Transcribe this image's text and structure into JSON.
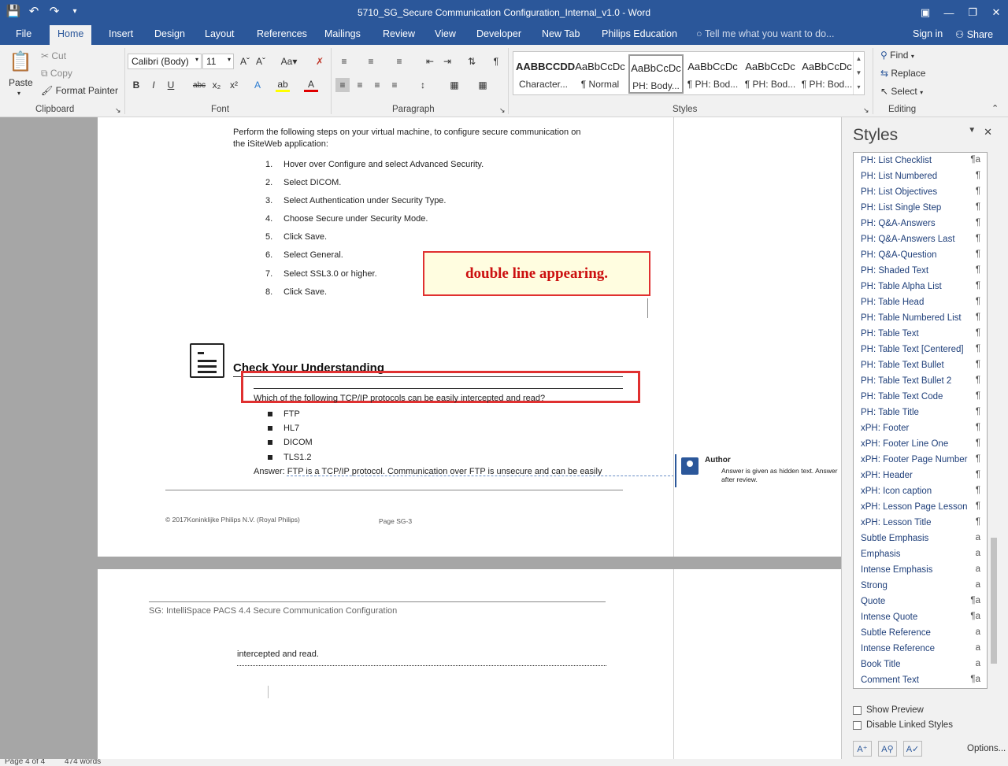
{
  "window": {
    "title": "5710_SG_Secure Communication Configuration_Internal_v1.0 - Word"
  },
  "tabs": [
    "File",
    "Home",
    "Insert",
    "Design",
    "Layout",
    "References",
    "Mailings",
    "Review",
    "View",
    "Developer",
    "New Tab",
    "Philips Education"
  ],
  "tell_me": "Tell me what you want to do...",
  "sign_in": "Sign in",
  "share": "Share",
  "ribbon": {
    "clipboard": {
      "paste": "Paste",
      "cut": "Cut",
      "copy": "Copy",
      "format_painter": "Format Painter",
      "label": "Clipboard"
    },
    "font": {
      "name": "Calibri (Body)",
      "size": "11",
      "label": "Font"
    },
    "paragraph": {
      "label": "Paragraph"
    },
    "styles": {
      "label": "Styles",
      "tiles": [
        {
          "preview": "AABBCCDD",
          "name": "Character..."
        },
        {
          "preview": "AaBbCcDc",
          "name": "¶ Normal"
        },
        {
          "preview": "AaBbCcDc",
          "name": "PH: Body..."
        },
        {
          "preview": "AaBbCcDc",
          "name": "¶ PH: Bod..."
        },
        {
          "preview": "AaBbCcDc",
          "name": "¶ PH: Bod..."
        },
        {
          "preview": "AaBbCcDc",
          "name": "¶ PH: Bod..."
        }
      ]
    },
    "editing": {
      "find": "Find",
      "replace": "Replace",
      "select": "Select",
      "label": "Editing"
    }
  },
  "document": {
    "intro_line1": "Perform the following steps on your virtual machine, to configure secure communication on",
    "intro_line2": "the iSiteWeb application:",
    "steps": [
      {
        "num": "1.",
        "text": "Hover over Configure and select Advanced Security."
      },
      {
        "num": "2.",
        "text": "Select DICOM."
      },
      {
        "num": "3.",
        "text": "Select Authentication under Security Type."
      },
      {
        "num": "4.",
        "text": "Choose Secure under Security Mode."
      },
      {
        "num": "5.",
        "text": "Click Save."
      },
      {
        "num": "6.",
        "text": "Select General."
      },
      {
        "num": "7.",
        "text": "Select SSL3.0 or higher."
      },
      {
        "num": "8.",
        "text": "Click Save."
      }
    ],
    "callout": "double line appearing.",
    "heading": "Check Your Understanding",
    "question": "Which of the following TCP/IP protocols can be easily intercepted and read?",
    "options": [
      "FTP",
      "HL7",
      "DICOM",
      "TLS1.2"
    ],
    "answer": "Answer: FTP is a TCP/IP protocol. Communication over FTP is unsecure and can be easily",
    "footer_copyright": "© 2017Koninklijke Philips N.V. (Royal Philips)",
    "footer_page": "Page SG-3",
    "comment_author": "Author",
    "comment_line1": "Answer is given as hidden text. Answer",
    "comment_line2": "after review.",
    "page2_header": "SG: IntelliSpace PACS 4.4 Secure Communication Configuration",
    "page2_text": "intercepted and read."
  },
  "styles_pane": {
    "title": "Styles",
    "items": [
      {
        "name": "PH: List Checklist",
        "mark": "¶a"
      },
      {
        "name": "PH: List Numbered",
        "mark": "¶"
      },
      {
        "name": "PH: List Objectives",
        "mark": "¶"
      },
      {
        "name": "PH: List Single Step",
        "mark": "¶"
      },
      {
        "name": "PH: Q&A-Answers",
        "mark": "¶"
      },
      {
        "name": "PH: Q&A-Answers Last",
        "mark": "¶"
      },
      {
        "name": "PH: Q&A-Question",
        "mark": "¶"
      },
      {
        "name": "PH: Shaded Text",
        "mark": "¶"
      },
      {
        "name": "PH: Table Alpha List",
        "mark": "¶"
      },
      {
        "name": "PH: Table Head",
        "mark": "¶"
      },
      {
        "name": "PH: Table Numbered List",
        "mark": "¶"
      },
      {
        "name": "PH: Table Text",
        "mark": "¶"
      },
      {
        "name": "PH: Table Text [Centered]",
        "mark": "¶"
      },
      {
        "name": "PH: Table Text Bullet",
        "mark": "¶"
      },
      {
        "name": "PH: Table Text Bullet 2",
        "mark": "¶"
      },
      {
        "name": "PH: Table Text Code",
        "mark": "¶"
      },
      {
        "name": "PH: Table Title",
        "mark": "¶"
      },
      {
        "name": "xPH: Footer",
        "mark": "¶"
      },
      {
        "name": "xPH: Footer Line One",
        "mark": "¶"
      },
      {
        "name": "xPH: Footer Page Number",
        "mark": "¶"
      },
      {
        "name": "xPH: Header",
        "mark": "¶"
      },
      {
        "name": "xPH: Icon caption",
        "mark": "¶"
      },
      {
        "name": "xPH: Lesson Page Lesson",
        "mark": "¶"
      },
      {
        "name": "xPH: Lesson Title",
        "mark": "¶"
      },
      {
        "name": "Subtle Emphasis",
        "mark": "a"
      },
      {
        "name": "Emphasis",
        "mark": "a"
      },
      {
        "name": "Intense Emphasis",
        "mark": "a"
      },
      {
        "name": "Strong",
        "mark": "a"
      },
      {
        "name": "Quote",
        "mark": "¶a"
      },
      {
        "name": "Intense Quote",
        "mark": "¶a"
      },
      {
        "name": "Subtle Reference",
        "mark": "a"
      },
      {
        "name": "Intense Reference",
        "mark": "a"
      },
      {
        "name": "Book Title",
        "mark": "a"
      },
      {
        "name": "Comment Text",
        "mark": "¶a"
      }
    ],
    "show_preview": "Show Preview",
    "disable_linked": "Disable Linked Styles",
    "options": "Options..."
  },
  "status": {
    "page": "Page 4 of 4",
    "words": "474 words"
  }
}
